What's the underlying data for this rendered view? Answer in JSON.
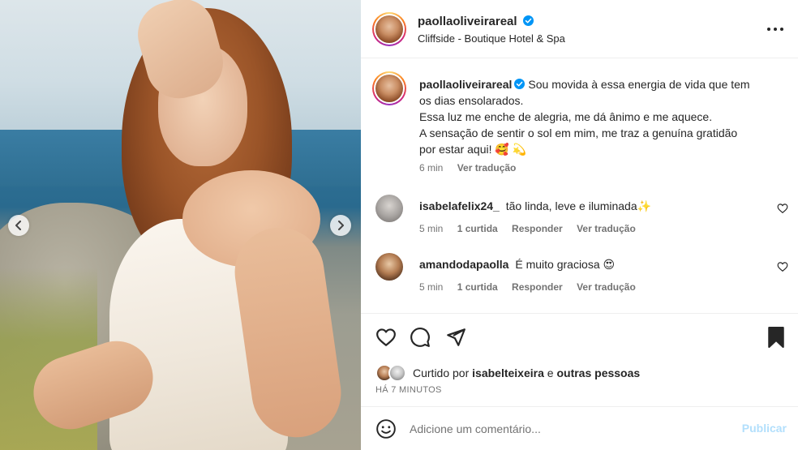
{
  "post": {
    "username": "paollaoliveirareal",
    "location": "Cliffside - Boutique Hotel & Spa"
  },
  "caption": {
    "username": "paollaoliveirareal",
    "lines": [
      "Sou movida à essa energia de vida que tem",
      "os dias ensolarados.",
      "Essa luz me enche de alegria, me dá ânimo e me aquece.",
      "A sensação de sentir o sol em mim, me traz a genuína gratidão",
      "por estar aqui! 🥰 💫"
    ],
    "time": "6 min",
    "translate": "Ver tradução"
  },
  "comments": [
    {
      "username": "isabelafelix24_",
      "text": "tão linda, leve e iluminada✨",
      "time": "5 min",
      "likes": "1 curtida",
      "reply": "Responder",
      "translate": "Ver tradução"
    },
    {
      "username": "amandodapaolla",
      "text": "É muito graciosa 😍",
      "time": "5 min",
      "likes": "1 curtida",
      "reply": "Responder",
      "translate": "Ver tradução"
    }
  ],
  "likes": {
    "prefix": "Curtido por",
    "user": "isabelteixeira",
    "and": "e",
    "others": "outras pessoas"
  },
  "time_ago": "HÁ 7 MINUTOS",
  "add_comment": {
    "placeholder": "Adicione um comentário...",
    "post_label": "Publicar"
  },
  "colors": {
    "verified": "#0095f6",
    "post_disabled": "#b2dffc",
    "secondary_text": "#737373"
  }
}
